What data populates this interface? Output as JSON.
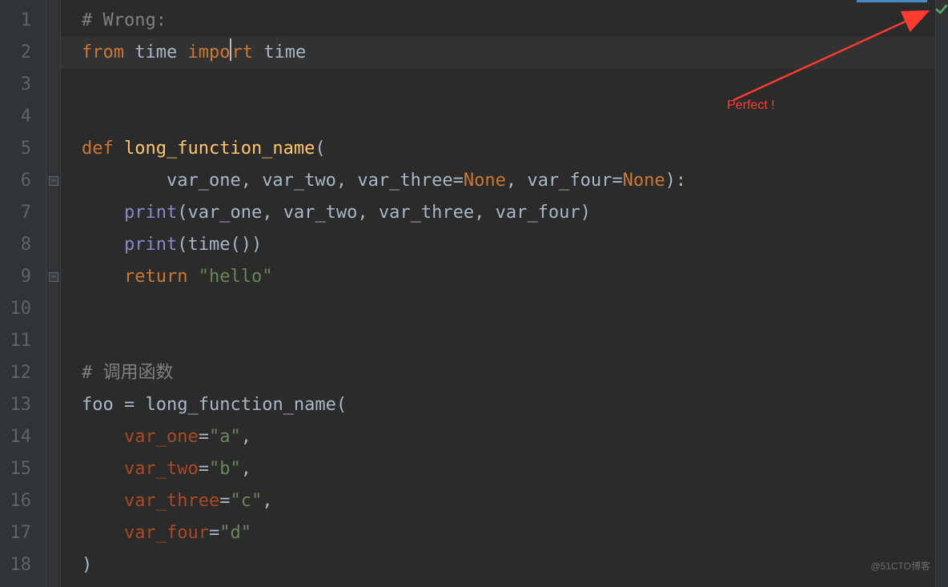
{
  "editor": {
    "theme": "darcula",
    "cursor_line": 2,
    "cursor_col_in_word": "after impo",
    "indent_unit": 4,
    "highlighted_line": 2,
    "gutter": {
      "start": 1,
      "end": 18
    },
    "fold_markers": [
      {
        "line": 6,
        "type": "region-open"
      },
      {
        "line": 9,
        "type": "region-close"
      }
    ],
    "lines": [
      {
        "n": 1,
        "indent": 0,
        "tokens": [
          {
            "t": "# Wrong:",
            "cls": "cmt"
          }
        ]
      },
      {
        "n": 2,
        "indent": 0,
        "hl": true,
        "tokens": [
          {
            "t": "from",
            "cls": "kw"
          },
          {
            "t": " ",
            "cls": "text"
          },
          {
            "t": "time",
            "cls": "id"
          },
          {
            "t": " ",
            "cls": "text"
          },
          {
            "t": "impo",
            "cls": "kw"
          },
          {
            "cursor": true
          },
          {
            "t": "rt",
            "cls": "kw"
          },
          {
            "t": " ",
            "cls": "text"
          },
          {
            "t": "time",
            "cls": "id"
          }
        ]
      },
      {
        "n": 3,
        "indent": 0,
        "tokens": []
      },
      {
        "n": 4,
        "indent": 0,
        "tokens": []
      },
      {
        "n": 5,
        "indent": 0,
        "tokens": [
          {
            "t": "def",
            "cls": "kw"
          },
          {
            "t": " ",
            "cls": "text"
          },
          {
            "t": "long_function_name",
            "cls": "fn"
          },
          {
            "t": "(",
            "cls": "op"
          }
        ]
      },
      {
        "n": 6,
        "indent": 8,
        "tokens": [
          {
            "t": "var_one",
            "cls": "id"
          },
          {
            "t": ", ",
            "cls": "op"
          },
          {
            "t": "var_two",
            "cls": "id"
          },
          {
            "t": ", ",
            "cls": "op"
          },
          {
            "t": "var_three",
            "cls": "id"
          },
          {
            "t": "=",
            "cls": "op"
          },
          {
            "t": "None",
            "cls": "none"
          },
          {
            "t": ", ",
            "cls": "op"
          },
          {
            "t": "var_four",
            "cls": "id"
          },
          {
            "t": "=",
            "cls": "op"
          },
          {
            "t": "None",
            "cls": "none"
          },
          {
            "t": "):",
            "cls": "op"
          }
        ]
      },
      {
        "n": 7,
        "indent": 4,
        "tokens": [
          {
            "t": "print",
            "cls": "builtin"
          },
          {
            "t": "(",
            "cls": "op"
          },
          {
            "t": "var_one",
            "cls": "id"
          },
          {
            "t": ", ",
            "cls": "op"
          },
          {
            "t": "var_two",
            "cls": "id"
          },
          {
            "t": ", ",
            "cls": "op"
          },
          {
            "t": "var_three",
            "cls": "id"
          },
          {
            "t": ", ",
            "cls": "op"
          },
          {
            "t": "var_four",
            "cls": "id"
          },
          {
            "t": ")",
            "cls": "op"
          }
        ]
      },
      {
        "n": 8,
        "indent": 4,
        "tokens": [
          {
            "t": "print",
            "cls": "builtin"
          },
          {
            "t": "(",
            "cls": "op"
          },
          {
            "t": "time",
            "cls": "id"
          },
          {
            "t": "())",
            "cls": "op"
          }
        ]
      },
      {
        "n": 9,
        "indent": 4,
        "tokens": [
          {
            "t": "return",
            "cls": "kw"
          },
          {
            "t": " ",
            "cls": "text"
          },
          {
            "t": "\"hello\"",
            "cls": "str"
          }
        ]
      },
      {
        "n": 10,
        "indent": 0,
        "tokens": []
      },
      {
        "n": 11,
        "indent": 0,
        "tokens": []
      },
      {
        "n": 12,
        "indent": 0,
        "tokens": [
          {
            "t": "# 调用函数",
            "cls": "cmt"
          }
        ]
      },
      {
        "n": 13,
        "indent": 0,
        "tokens": [
          {
            "t": "foo",
            "cls": "id"
          },
          {
            "t": " = ",
            "cls": "op"
          },
          {
            "t": "long_function_name",
            "cls": "id"
          },
          {
            "t": "(",
            "cls": "op"
          }
        ]
      },
      {
        "n": 14,
        "indent": 4,
        "tokens": [
          {
            "t": "var_one",
            "cls": "arg"
          },
          {
            "t": "=",
            "cls": "op"
          },
          {
            "t": "\"a\"",
            "cls": "str"
          },
          {
            "t": ",",
            "cls": "op"
          }
        ]
      },
      {
        "n": 15,
        "indent": 4,
        "tokens": [
          {
            "t": "var_two",
            "cls": "arg"
          },
          {
            "t": "=",
            "cls": "op"
          },
          {
            "t": "\"b\"",
            "cls": "str"
          },
          {
            "t": ",",
            "cls": "op"
          }
        ]
      },
      {
        "n": 16,
        "indent": 4,
        "tokens": [
          {
            "t": "var_three",
            "cls": "arg"
          },
          {
            "t": "=",
            "cls": "op"
          },
          {
            "t": "\"c\"",
            "cls": "str"
          },
          {
            "t": ",",
            "cls": "op"
          }
        ]
      },
      {
        "n": 17,
        "indent": 4,
        "tokens": [
          {
            "t": "var_four",
            "cls": "arg"
          },
          {
            "t": "=",
            "cls": "op"
          },
          {
            "t": "\"d\"",
            "cls": "str"
          }
        ]
      },
      {
        "n": 18,
        "indent": 0,
        "tokens": [
          {
            "t": ")",
            "cls": "op"
          }
        ]
      }
    ]
  },
  "status": {
    "inspection": "ok",
    "icon": "check-icon",
    "color": "#59a869"
  },
  "annotation": {
    "text": "Perfect !",
    "color": "#ff3b30"
  },
  "watermark": "@51CTO博客",
  "accent": {
    "tab_underline": "#4a88c7"
  }
}
